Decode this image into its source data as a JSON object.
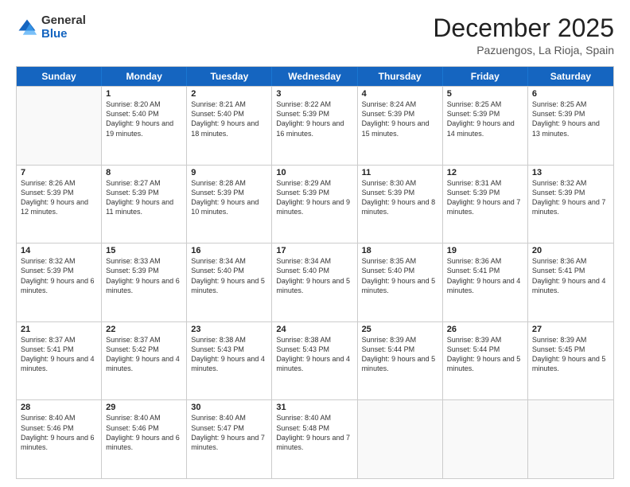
{
  "logo": {
    "general": "General",
    "blue": "Blue"
  },
  "header": {
    "month": "December 2025",
    "location": "Pazuengos, La Rioja, Spain"
  },
  "days": [
    "Sunday",
    "Monday",
    "Tuesday",
    "Wednesday",
    "Thursday",
    "Friday",
    "Saturday"
  ],
  "weeks": [
    [
      {
        "day": "",
        "sunrise": "",
        "sunset": "",
        "daylight": ""
      },
      {
        "day": "1",
        "sunrise": "Sunrise: 8:20 AM",
        "sunset": "Sunset: 5:40 PM",
        "daylight": "Daylight: 9 hours and 19 minutes."
      },
      {
        "day": "2",
        "sunrise": "Sunrise: 8:21 AM",
        "sunset": "Sunset: 5:40 PM",
        "daylight": "Daylight: 9 hours and 18 minutes."
      },
      {
        "day": "3",
        "sunrise": "Sunrise: 8:22 AM",
        "sunset": "Sunset: 5:39 PM",
        "daylight": "Daylight: 9 hours and 16 minutes."
      },
      {
        "day": "4",
        "sunrise": "Sunrise: 8:24 AM",
        "sunset": "Sunset: 5:39 PM",
        "daylight": "Daylight: 9 hours and 15 minutes."
      },
      {
        "day": "5",
        "sunrise": "Sunrise: 8:25 AM",
        "sunset": "Sunset: 5:39 PM",
        "daylight": "Daylight: 9 hours and 14 minutes."
      },
      {
        "day": "6",
        "sunrise": "Sunrise: 8:25 AM",
        "sunset": "Sunset: 5:39 PM",
        "daylight": "Daylight: 9 hours and 13 minutes."
      }
    ],
    [
      {
        "day": "7",
        "sunrise": "Sunrise: 8:26 AM",
        "sunset": "Sunset: 5:39 PM",
        "daylight": "Daylight: 9 hours and 12 minutes."
      },
      {
        "day": "8",
        "sunrise": "Sunrise: 8:27 AM",
        "sunset": "Sunset: 5:39 PM",
        "daylight": "Daylight: 9 hours and 11 minutes."
      },
      {
        "day": "9",
        "sunrise": "Sunrise: 8:28 AM",
        "sunset": "Sunset: 5:39 PM",
        "daylight": "Daylight: 9 hours and 10 minutes."
      },
      {
        "day": "10",
        "sunrise": "Sunrise: 8:29 AM",
        "sunset": "Sunset: 5:39 PM",
        "daylight": "Daylight: 9 hours and 9 minutes."
      },
      {
        "day": "11",
        "sunrise": "Sunrise: 8:30 AM",
        "sunset": "Sunset: 5:39 PM",
        "daylight": "Daylight: 9 hours and 8 minutes."
      },
      {
        "day": "12",
        "sunrise": "Sunrise: 8:31 AM",
        "sunset": "Sunset: 5:39 PM",
        "daylight": "Daylight: 9 hours and 7 minutes."
      },
      {
        "day": "13",
        "sunrise": "Sunrise: 8:32 AM",
        "sunset": "Sunset: 5:39 PM",
        "daylight": "Daylight: 9 hours and 7 minutes."
      }
    ],
    [
      {
        "day": "14",
        "sunrise": "Sunrise: 8:32 AM",
        "sunset": "Sunset: 5:39 PM",
        "daylight": "Daylight: 9 hours and 6 minutes."
      },
      {
        "day": "15",
        "sunrise": "Sunrise: 8:33 AM",
        "sunset": "Sunset: 5:39 PM",
        "daylight": "Daylight: 9 hours and 6 minutes."
      },
      {
        "day": "16",
        "sunrise": "Sunrise: 8:34 AM",
        "sunset": "Sunset: 5:40 PM",
        "daylight": "Daylight: 9 hours and 5 minutes."
      },
      {
        "day": "17",
        "sunrise": "Sunrise: 8:34 AM",
        "sunset": "Sunset: 5:40 PM",
        "daylight": "Daylight: 9 hours and 5 minutes."
      },
      {
        "day": "18",
        "sunrise": "Sunrise: 8:35 AM",
        "sunset": "Sunset: 5:40 PM",
        "daylight": "Daylight: 9 hours and 5 minutes."
      },
      {
        "day": "19",
        "sunrise": "Sunrise: 8:36 AM",
        "sunset": "Sunset: 5:41 PM",
        "daylight": "Daylight: 9 hours and 4 minutes."
      },
      {
        "day": "20",
        "sunrise": "Sunrise: 8:36 AM",
        "sunset": "Sunset: 5:41 PM",
        "daylight": "Daylight: 9 hours and 4 minutes."
      }
    ],
    [
      {
        "day": "21",
        "sunrise": "Sunrise: 8:37 AM",
        "sunset": "Sunset: 5:41 PM",
        "daylight": "Daylight: 9 hours and 4 minutes."
      },
      {
        "day": "22",
        "sunrise": "Sunrise: 8:37 AM",
        "sunset": "Sunset: 5:42 PM",
        "daylight": "Daylight: 9 hours and 4 minutes."
      },
      {
        "day": "23",
        "sunrise": "Sunrise: 8:38 AM",
        "sunset": "Sunset: 5:43 PM",
        "daylight": "Daylight: 9 hours and 4 minutes."
      },
      {
        "day": "24",
        "sunrise": "Sunrise: 8:38 AM",
        "sunset": "Sunset: 5:43 PM",
        "daylight": "Daylight: 9 hours and 4 minutes."
      },
      {
        "day": "25",
        "sunrise": "Sunrise: 8:39 AM",
        "sunset": "Sunset: 5:44 PM",
        "daylight": "Daylight: 9 hours and 5 minutes."
      },
      {
        "day": "26",
        "sunrise": "Sunrise: 8:39 AM",
        "sunset": "Sunset: 5:44 PM",
        "daylight": "Daylight: 9 hours and 5 minutes."
      },
      {
        "day": "27",
        "sunrise": "Sunrise: 8:39 AM",
        "sunset": "Sunset: 5:45 PM",
        "daylight": "Daylight: 9 hours and 5 minutes."
      }
    ],
    [
      {
        "day": "28",
        "sunrise": "Sunrise: 8:40 AM",
        "sunset": "Sunset: 5:46 PM",
        "daylight": "Daylight: 9 hours and 6 minutes."
      },
      {
        "day": "29",
        "sunrise": "Sunrise: 8:40 AM",
        "sunset": "Sunset: 5:46 PM",
        "daylight": "Daylight: 9 hours and 6 minutes."
      },
      {
        "day": "30",
        "sunrise": "Sunrise: 8:40 AM",
        "sunset": "Sunset: 5:47 PM",
        "daylight": "Daylight: 9 hours and 7 minutes."
      },
      {
        "day": "31",
        "sunrise": "Sunrise: 8:40 AM",
        "sunset": "Sunset: 5:48 PM",
        "daylight": "Daylight: 9 hours and 7 minutes."
      },
      {
        "day": "",
        "sunrise": "",
        "sunset": "",
        "daylight": ""
      },
      {
        "day": "",
        "sunrise": "",
        "sunset": "",
        "daylight": ""
      },
      {
        "day": "",
        "sunrise": "",
        "sunset": "",
        "daylight": ""
      }
    ]
  ]
}
